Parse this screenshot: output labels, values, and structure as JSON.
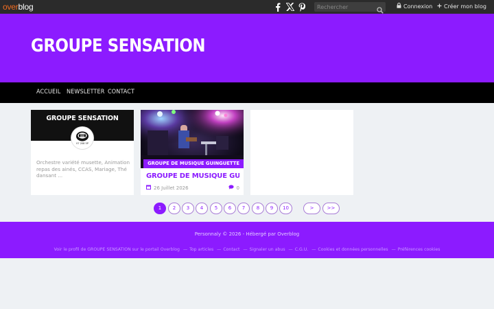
{
  "topbar": {
    "logo_part1": "over",
    "logo_part2": "blog",
    "search_placeholder": "Rechercher",
    "login_label": "Connexion",
    "create_label": "Créer mon blog"
  },
  "header": {
    "site_title": "GROUPE SENSATION"
  },
  "nav": {
    "items": [
      "ACCUEIL",
      "NEWSLETTER",
      "CONTACT"
    ]
  },
  "card1": {
    "title": "GROUPE SENSATION",
    "avatar_caption": "07 208 5P",
    "description": "Orchestre variété musette, Animation repas des ainés, CCAS, Mariage, Thé dansant ..."
  },
  "card2": {
    "category": "GROUPE DE MUSIQUE GUINGUETTE",
    "title": "GROUPE DE MUSIQUE GUINGUE…",
    "date": "26 Juillet 2026",
    "comments": "0"
  },
  "pagination": {
    "pages": [
      "1",
      "2",
      "3",
      "4",
      "5",
      "6",
      "7",
      "8",
      "9",
      "10"
    ],
    "next": ">",
    "last": ">>",
    "current": 1
  },
  "footer": {
    "copyright": "Personnaly © 2026 -  Hébergé par ",
    "host": "Overblog",
    "profile_prefix": "Voir le profil de ",
    "profile_name": "GROUPE SENSATION",
    "profile_suffix": " sur le portail Overblog",
    "links": [
      "Top articles",
      "Contact",
      "Signaler un abus",
      "C.G.U.",
      "Cookies et données personnelles",
      "Préférences cookies"
    ]
  },
  "colors": {
    "accent": "#8c1bff",
    "topbar": "#2b2b2b",
    "nav": "#000000",
    "background": "#eef1f4"
  },
  "icons": [
    "facebook-icon",
    "x-icon",
    "pinterest-icon",
    "search-icon",
    "lock-icon",
    "plus-icon",
    "calendar-icon",
    "comment-icon"
  ]
}
